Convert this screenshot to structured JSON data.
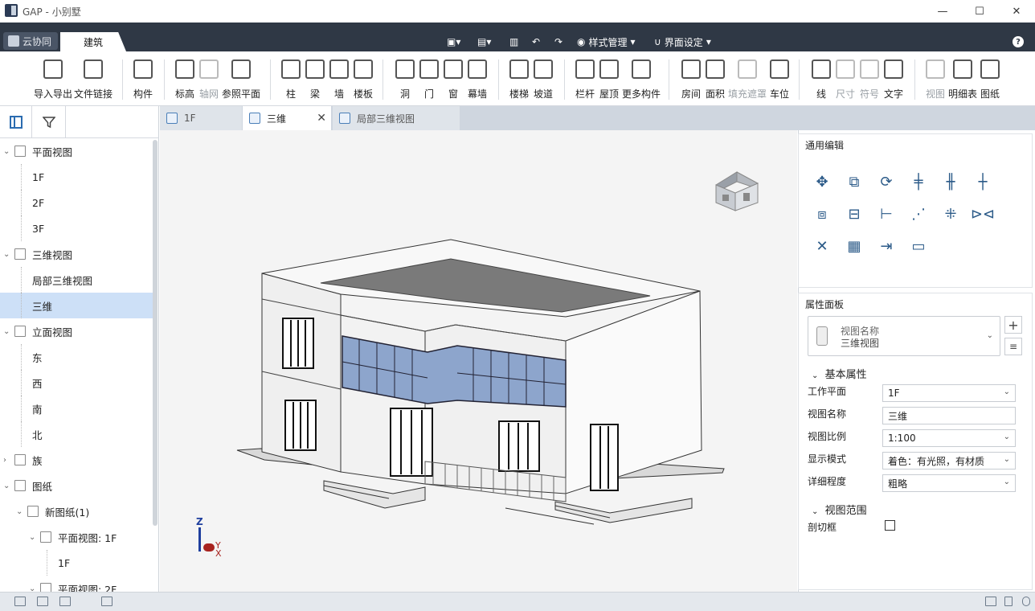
{
  "window": {
    "title": "GAP - 小别墅"
  },
  "tabs": {
    "cloud": "云协同",
    "arch": "建筑"
  },
  "qat": {
    "style": "样式管理",
    "ui": "界面设定"
  },
  "ribbon": [
    {
      "id": "import",
      "label": "导入导出",
      "icon": "cad-import-icon",
      "disabled": false
    },
    {
      "id": "filelink",
      "label": "文件链接",
      "icon": "file-link-icon",
      "disabled": false
    },
    {
      "id": "component",
      "label": "构件",
      "icon": "component-icon",
      "disabled": false
    },
    {
      "id": "level",
      "label": "标高",
      "icon": "level-icon",
      "disabled": false
    },
    {
      "id": "grid",
      "label": "轴网",
      "icon": "grid-icon",
      "disabled": true
    },
    {
      "id": "refplane",
      "label": "参照平面",
      "icon": "ref-plane-icon",
      "disabled": false
    },
    {
      "id": "column",
      "label": "柱",
      "icon": "column-icon",
      "disabled": false
    },
    {
      "id": "beam",
      "label": "梁",
      "icon": "beam-icon",
      "disabled": false
    },
    {
      "id": "wall",
      "label": "墙",
      "icon": "wall-icon",
      "disabled": false
    },
    {
      "id": "floor",
      "label": "楼板",
      "icon": "floor-icon",
      "disabled": false
    },
    {
      "id": "opening",
      "label": "洞",
      "icon": "opening-icon",
      "disabled": false
    },
    {
      "id": "door",
      "label": "门",
      "icon": "door-icon",
      "disabled": false
    },
    {
      "id": "window",
      "label": "窗",
      "icon": "window-icon",
      "disabled": false
    },
    {
      "id": "curtain",
      "label": "幕墙",
      "icon": "curtain-wall-icon",
      "disabled": false
    },
    {
      "id": "stair",
      "label": "楼梯",
      "icon": "stair-icon",
      "disabled": false
    },
    {
      "id": "ramp",
      "label": "坡道",
      "icon": "ramp-icon",
      "disabled": false
    },
    {
      "id": "railing",
      "label": "栏杆",
      "icon": "railing-icon",
      "disabled": false
    },
    {
      "id": "roof",
      "label": "屋顶",
      "icon": "roof-icon",
      "disabled": false
    },
    {
      "id": "more",
      "label": "更多构件",
      "icon": "more-components-icon",
      "disabled": false
    },
    {
      "id": "room",
      "label": "房间",
      "icon": "room-icon",
      "disabled": false
    },
    {
      "id": "area",
      "label": "面积",
      "icon": "area-icon",
      "disabled": false
    },
    {
      "id": "fill",
      "label": "填充遮罩",
      "icon": "fill-mask-icon",
      "disabled": true
    },
    {
      "id": "parking",
      "label": "车位",
      "icon": "parking-icon",
      "disabled": false
    },
    {
      "id": "line",
      "label": "线",
      "icon": "line-icon",
      "disabled": false
    },
    {
      "id": "dim",
      "label": "尺寸",
      "icon": "dimension-icon",
      "disabled": true
    },
    {
      "id": "symbol",
      "label": "符号",
      "icon": "symbol-icon",
      "disabled": true
    },
    {
      "id": "text",
      "label": "文字",
      "icon": "text-icon",
      "disabled": false
    },
    {
      "id": "view",
      "label": "视图",
      "icon": "view-icon",
      "disabled": true
    },
    {
      "id": "schedule",
      "label": "明细表",
      "icon": "schedule-icon",
      "disabled": false
    },
    {
      "id": "sheet",
      "label": "图纸",
      "icon": "sheet-icon",
      "disabled": false
    }
  ],
  "tree": [
    {
      "label": "平面视图",
      "level": 0,
      "arrow": "open",
      "icon": true
    },
    {
      "label": "1F",
      "level": 1
    },
    {
      "label": "2F",
      "level": 1
    },
    {
      "label": "3F",
      "level": 1
    },
    {
      "label": "三维视图",
      "level": 0,
      "arrow": "open",
      "icon": true
    },
    {
      "label": "局部三维视图",
      "level": 1
    },
    {
      "label": "三维",
      "level": 1,
      "selected": true
    },
    {
      "label": "立面视图",
      "level": 0,
      "arrow": "open",
      "icon": true
    },
    {
      "label": "东",
      "level": 1
    },
    {
      "label": "西",
      "level": 1
    },
    {
      "label": "南",
      "level": 1
    },
    {
      "label": "北",
      "level": 1
    },
    {
      "label": "族",
      "level": 0,
      "arrow": "closed",
      "icon": true
    },
    {
      "label": "图纸",
      "level": 0,
      "arrow": "open",
      "icon": true
    },
    {
      "label": "新图纸(1)",
      "level": 1,
      "arrow": "open",
      "icon": true
    },
    {
      "label": "平面视图: 1F",
      "level": 2,
      "arrow": "open",
      "icon": true
    },
    {
      "label": "1F",
      "level": 3
    },
    {
      "label": "平面视图: 2F",
      "level": 2,
      "arrow": "open",
      "icon": true
    }
  ],
  "doctabs": {
    "t1": "1F",
    "t2": "三维",
    "t3": "局部三维视图"
  },
  "axes": {
    "z": "Z",
    "y": "Y",
    "x": "X"
  },
  "edit": {
    "title": "通用编辑"
  },
  "props": {
    "title": "属性面板",
    "type_label": "视图名称",
    "type_value": "三维视图",
    "basic_section": "基本属性",
    "work_plane_label": "工作平面",
    "work_plane": "1F",
    "view_name_label": "视图名称",
    "view_name": "三维",
    "scale_label": "视图比例",
    "scale": "1:100",
    "display_label": "显示模式",
    "display": "着色：有光照，有材质",
    "detail_label": "详细程度",
    "detail": "粗略",
    "range_section": "视图范围",
    "crop_label": "剖切框"
  }
}
